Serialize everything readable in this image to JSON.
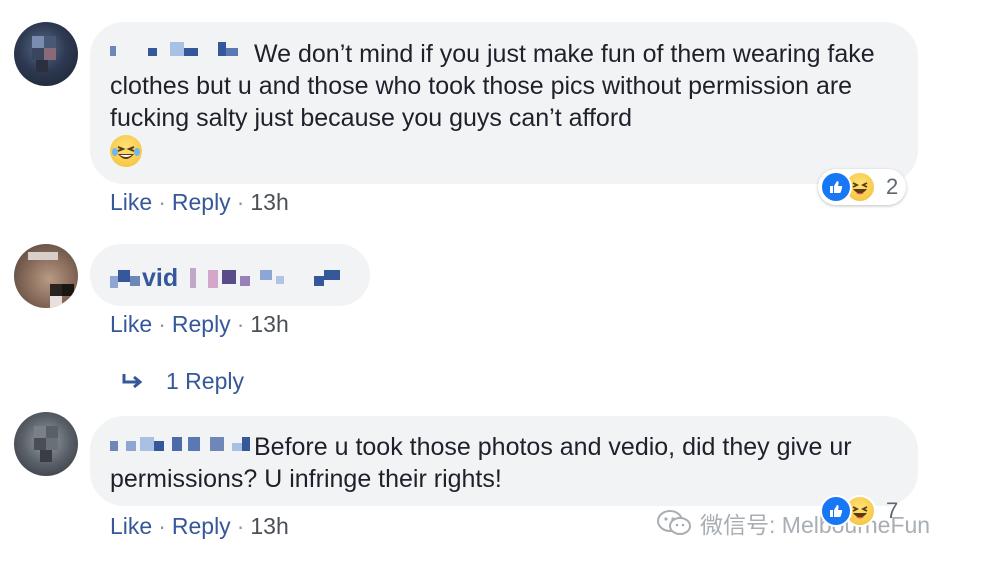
{
  "comments": [
    {
      "text": "We don’t mind if you just make fun of them wearing fake clothes but u and those who took those pics without permission are fucking salty just because you guys can’t afford",
      "emoji": "laughing-emoji",
      "reactions": {
        "count": "2",
        "types": [
          "like",
          "haha"
        ]
      },
      "actions": {
        "like": "Like",
        "reply": "Reply",
        "time": "13h",
        "sep": "·"
      }
    },
    {
      "author_visible_fragment": "vid",
      "actions": {
        "like": "Like",
        "reply": "Reply",
        "time": "13h",
        "sep": "·"
      },
      "replies_link": "1 Reply"
    },
    {
      "text": "Before u took those photos and vedio, did they give ur permissions? U infringe their rights!",
      "reactions": {
        "count": "7",
        "types": [
          "like",
          "haha"
        ]
      },
      "actions": {
        "like": "Like",
        "reply": "Reply",
        "time": "13h",
        "sep": "·"
      }
    }
  ],
  "watermark": "微信号: MelbourneFun",
  "colors": {
    "link": "#365899",
    "bubble": "#f2f3f5",
    "like_blue": "#1877f2"
  }
}
